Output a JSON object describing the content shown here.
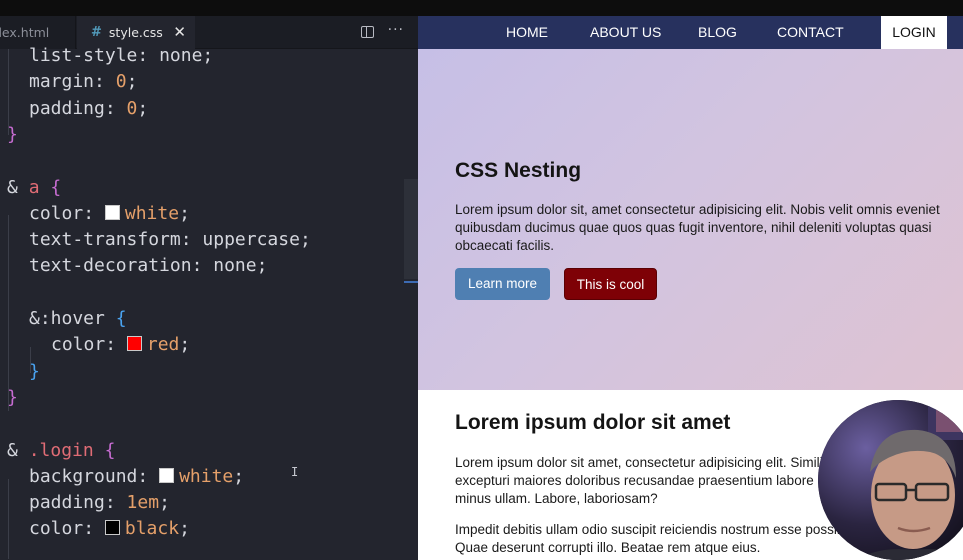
{
  "editor": {
    "tabs": [
      {
        "label": "index.html",
        "visible_label": "dex.html",
        "active": false
      },
      {
        "label": "style.css",
        "active": true
      }
    ],
    "active_tab_icon": "#",
    "close_glyph": "✕",
    "actions": {
      "split_icon": "split-editor-icon",
      "more_glyph": "···"
    },
    "code_lines": [
      {
        "indent": 1,
        "prop": "list-style",
        "value": "none",
        "value_kind": "plain"
      },
      {
        "indent": 1,
        "prop": "margin",
        "value": "0",
        "value_kind": "num"
      },
      {
        "indent": 1,
        "prop": "padding",
        "value": "0",
        "value_kind": "num"
      },
      {
        "indent": 0,
        "brace": "}"
      },
      {
        "blank": true
      },
      {
        "indent": 0,
        "selector": "a",
        "prefix": "& ",
        "open": "{"
      },
      {
        "indent": 1,
        "prop": "color",
        "value": "white",
        "value_kind": "color",
        "swatch": "#ffffff"
      },
      {
        "indent": 1,
        "prop": "text-transform",
        "value": "uppercase",
        "value_kind": "plain"
      },
      {
        "indent": 1,
        "prop": "text-decoration",
        "value": "none",
        "value_kind": "plain"
      },
      {
        "blank": true
      },
      {
        "indent": 1,
        "pseudo": "&:hover",
        "open": "{"
      },
      {
        "indent": 2,
        "prop": "color",
        "value": "red",
        "value_kind": "color",
        "swatch": "#ff0000"
      },
      {
        "indent": 1,
        "brace": "}",
        "brace_color": "blue"
      },
      {
        "indent": 0,
        "brace": "}"
      },
      {
        "blank": true
      },
      {
        "indent": 0,
        "selector": ".login",
        "prefix": "& ",
        "open": "{"
      },
      {
        "indent": 1,
        "prop": "background",
        "value": "white",
        "value_kind": "color",
        "swatch": "#ffffff"
      },
      {
        "indent": 1,
        "prop": "padding",
        "value": "1em",
        "value_kind": "num"
      },
      {
        "indent": 1,
        "prop": "color",
        "value": "black",
        "value_kind": "color",
        "swatch": "#000000"
      }
    ]
  },
  "preview": {
    "nav": {
      "links": [
        "HOME",
        "ABOUT US",
        "BLOG",
        "CONTACT"
      ],
      "login": "LOGIN",
      "bg_color": "#27315e"
    },
    "hero": {
      "title": "CSS Nesting",
      "text": "Lorem ipsum dolor sit, amet consectetur adipisicing elit. Nobis velit omnis eveniet quibusdam ducimus quae quos quas fugit inventore, nihil deleniti voluptas quasi obcaecati facilis.",
      "buttons": [
        {
          "label": "Learn more",
          "color": "#4f7fb2"
        },
        {
          "label": "This is cool",
          "color": "#7e0106"
        }
      ]
    },
    "section": {
      "title": "Lorem ipsum dolor sit amet",
      "p1": "Lorem ipsum dolor sit amet, consectetur adipisicing elit. Similique provident officiis excepturi maiores doloribus recusandae praesentium labore debitis nemo harum minus ullam. Labore, laboriosam?",
      "p2": "Impedit debitis ullam odio suscipit reiciendis nostrum esse possimus voluptatum at. Quae deserunt corrupti illo. Beatae rem atque eius."
    }
  }
}
